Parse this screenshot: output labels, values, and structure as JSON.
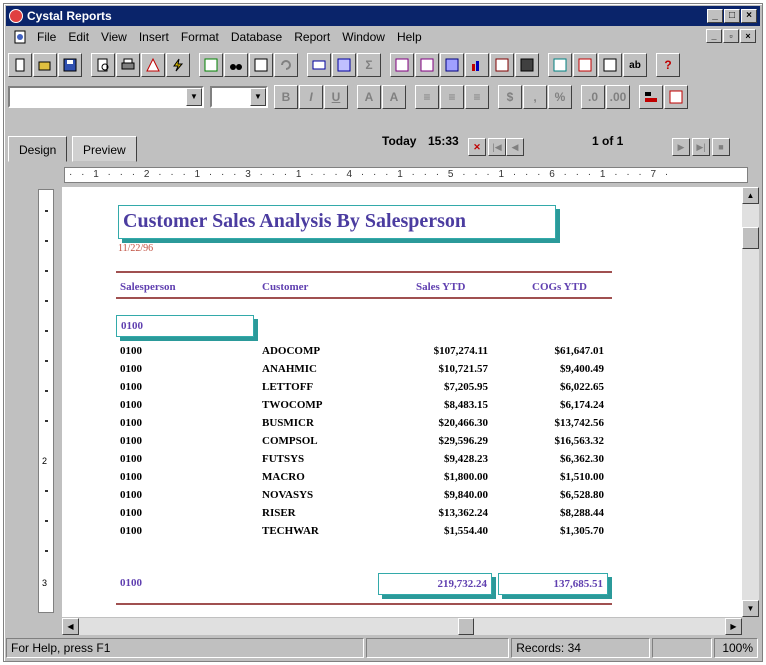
{
  "window": {
    "title": "Cystal Reports"
  },
  "menu": [
    "File",
    "Edit",
    "View",
    "Insert",
    "Format",
    "Database",
    "Report",
    "Window",
    "Help"
  ],
  "tabs": {
    "design": "Design",
    "preview": "Preview"
  },
  "nav": {
    "today": "Today",
    "time": "15:33",
    "page": "1 of 1"
  },
  "ruler_text": "· · 1 · · · 2 · · · 1 · · · 3 · · · 1 · · · 4 · · · 1 · · · 5 · · · 1 · · · 6 · · · 1 · · · 7 ·",
  "report": {
    "title": "Customer Sales Analysis By Salesperson",
    "date": "11/22/96",
    "columns": {
      "salesperson": "Salesperson",
      "customer": "Customer",
      "sales": "Sales YTD",
      "cogs": "COGs YTD"
    },
    "group": "0100",
    "rows": [
      {
        "sp": "0100",
        "customer": "ADOCOMP",
        "sales": "$107,274.11",
        "cogs": "$61,647.01"
      },
      {
        "sp": "0100",
        "customer": "ANAHMIC",
        "sales": "$10,721.57",
        "cogs": "$9,400.49"
      },
      {
        "sp": "0100",
        "customer": "LETTOFF",
        "sales": "$7,205.95",
        "cogs": "$6,022.65"
      },
      {
        "sp": "0100",
        "customer": "TWOCOMP",
        "sales": "$8,483.15",
        "cogs": "$6,174.24"
      },
      {
        "sp": "0100",
        "customer": "BUSMICR",
        "sales": "$20,466.30",
        "cogs": "$13,742.56"
      },
      {
        "sp": "0100",
        "customer": "COMPSOL",
        "sales": "$29,596.29",
        "cogs": "$16,563.32"
      },
      {
        "sp": "0100",
        "customer": "FUTSYS",
        "sales": "$9,428.23",
        "cogs": "$6,362.30"
      },
      {
        "sp": "0100",
        "customer": "MACRO",
        "sales": "$1,800.00",
        "cogs": "$1,510.00"
      },
      {
        "sp": "0100",
        "customer": "NOVASYS",
        "sales": "$9,840.00",
        "cogs": "$6,528.80"
      },
      {
        "sp": "0100",
        "customer": "RISER",
        "sales": "$13,362.24",
        "cogs": "$8,288.44"
      },
      {
        "sp": "0100",
        "customer": "TECHWAR",
        "sales": "$1,554.40",
        "cogs": "$1,305.70"
      }
    ],
    "total": {
      "label": "0100",
      "sales": "219,732.24",
      "cogs": "137,685.51"
    }
  },
  "status": {
    "help": "For Help, press F1",
    "records": "Records: 34",
    "zoom": "100%"
  }
}
